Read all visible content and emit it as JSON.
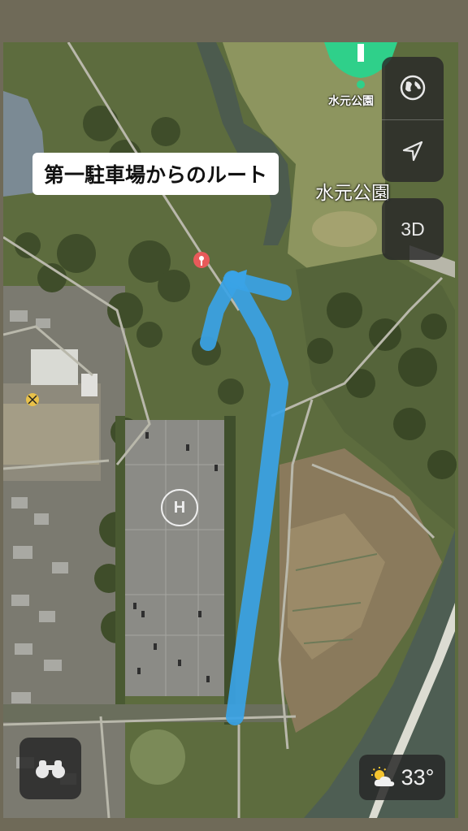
{
  "map": {
    "route_label": "第一駐車場からのルート",
    "park_label": "水元公園",
    "pin_label": "水元公園",
    "route_color": "#3aa3e6",
    "pin_color": "#2fd08a",
    "marker_color": "#e85a5a"
  },
  "controls": {
    "globe_icon": "globe-icon",
    "location_icon": "location-arrow-icon",
    "three_d_label": "3D",
    "lookaround_icon": "binoculars-icon"
  },
  "weather": {
    "icon": "partly-sunny-icon",
    "temperature": "33°"
  }
}
